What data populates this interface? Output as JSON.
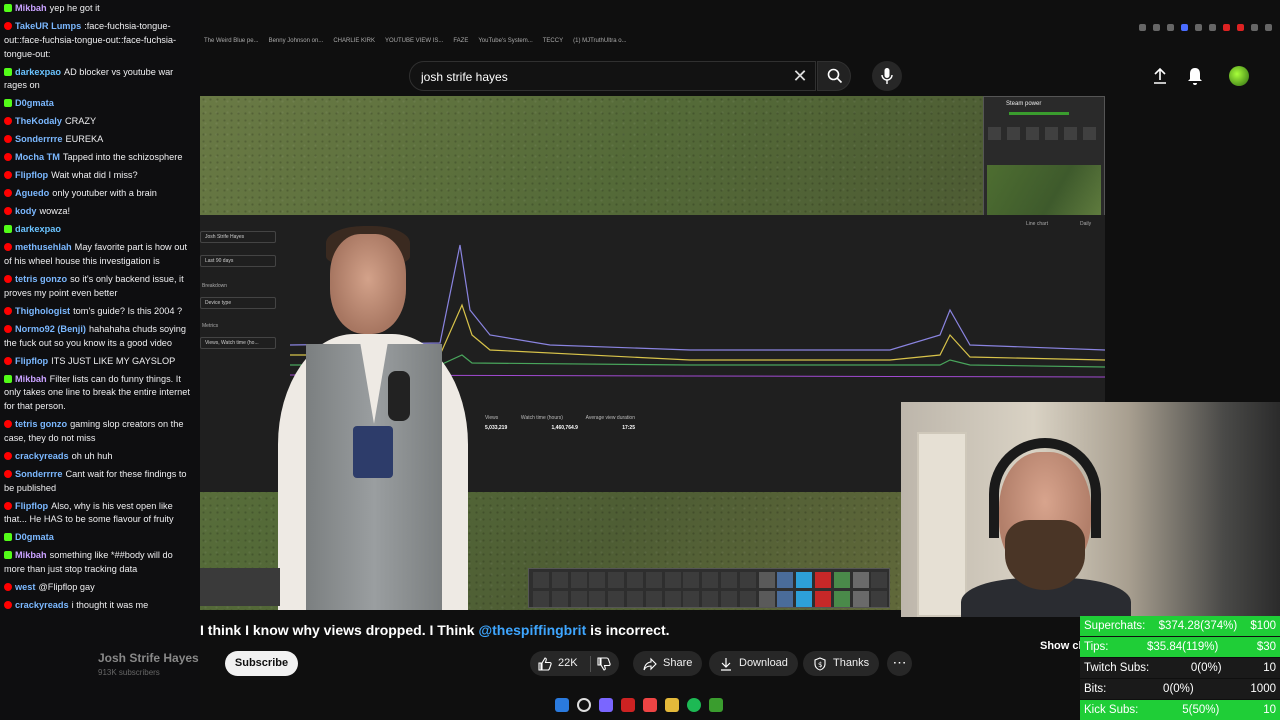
{
  "chat": {
    "messages": [
      {
        "user": "Mikbah",
        "text": "yep he got it",
        "platform": "kick",
        "color": "#c9a1ff"
      },
      {
        "user": "TakeUR Lumps",
        "text": ":face-fuchsia-tongue-out::face-fuchsia-tongue-out::face-fuchsia-tongue-out:",
        "platform": "yt",
        "color": "#7bb8ff"
      },
      {
        "user": "darkexpao",
        "text": "AD blocker vs youtube war rages on",
        "platform": "kick",
        "color": "#6ac3ff"
      },
      {
        "user": "D0gmata",
        "text": "",
        "platform": "kick",
        "color": "#7bb8ff"
      },
      {
        "user": "TheKodaly",
        "text": "CRAZY",
        "platform": "yt",
        "color": "#7bb8ff"
      },
      {
        "user": "Sonderrrre",
        "text": "EUREKA",
        "platform": "yt",
        "color": "#7bb8ff"
      },
      {
        "user": "Mocha TM",
        "text": "Tapped into the schizosphere",
        "platform": "yt",
        "color": "#7bb8ff"
      },
      {
        "user": "Flipflop",
        "text": "Wait what did I miss?",
        "platform": "yt",
        "color": "#7bb8ff"
      },
      {
        "user": "Aguedo",
        "text": "only youtuber with a brain",
        "platform": "yt",
        "color": "#7bb8ff"
      },
      {
        "user": "kody",
        "text": "wowza!",
        "platform": "yt",
        "color": "#7bb8ff"
      },
      {
        "user": "darkexpao",
        "text": "",
        "platform": "kick",
        "color": "#6ac3ff"
      },
      {
        "user": "methusehlah",
        "text": "May favorite part is how out of his wheel house this investigation is",
        "platform": "yt",
        "color": "#7bb8ff"
      },
      {
        "user": "tetris gonzo",
        "text": "so it's only backend issue, it proves my point even better",
        "platform": "yt",
        "color": "#7bb8ff"
      },
      {
        "user": "Thighologist",
        "text": "tom's guide? Is this 2004 ?",
        "platform": "yt",
        "color": "#7bb8ff"
      },
      {
        "user": "Normo92 (Benji)",
        "text": "hahahaha chuds soying the fuck out so you know its a good video",
        "platform": "yt",
        "color": "#7bb8ff"
      },
      {
        "user": "Flipflop",
        "text": "ITS JUST LIKE MY GAYSLOP",
        "platform": "yt",
        "color": "#7bb8ff"
      },
      {
        "user": "Mikbah",
        "text": "Filter lists can do funny things. It only takes one line to break the entire internet for that person.",
        "platform": "kick",
        "color": "#c9a1ff"
      },
      {
        "user": "tetris gonzo",
        "text": "gaming slop creators on the case, they do not miss",
        "platform": "yt",
        "color": "#7bb8ff"
      },
      {
        "user": "crackyreads",
        "text": "oh uh huh",
        "platform": "yt",
        "color": "#7bb8ff"
      },
      {
        "user": "Sonderrrre",
        "text": "Cant wait for these findings to be published",
        "platform": "yt",
        "color": "#7bb8ff"
      },
      {
        "user": "Flipflop",
        "text": "Also, why is his vest open like that... He HAS to be some flavour of fruity",
        "platform": "yt",
        "color": "#7bb8ff"
      },
      {
        "user": "D0gmata",
        "text": "",
        "platform": "kick",
        "color": "#7bb8ff"
      },
      {
        "user": "Mikbah",
        "text": "something like *##body will do more than just stop tracking data",
        "platform": "kick",
        "color": "#c9a1ff"
      },
      {
        "user": "west",
        "text": "@Flipflop gay",
        "platform": "yt",
        "color": "#7bb8ff"
      },
      {
        "user": "crackyreads",
        "text": "i thought it was me",
        "platform": "yt",
        "color": "#7bb8ff"
      }
    ]
  },
  "bookmarks": [
    "The Weird Blue pe...",
    "Benny Johnson on...",
    "CHARLIE KIRK",
    "YOUTUBE VIEW IS...",
    "FAZE",
    "YouTube's System...",
    "TECCY",
    "(1) MJTruthUltra o..."
  ],
  "search": {
    "value": "josh strife hayes",
    "placeholder": "Search"
  },
  "video": {
    "minimap_title": "Steam power",
    "analytics": {
      "channel_select": "Josh Strife Hayes",
      "range_select": "Last 90 days",
      "breakdown_label": "Breakdown",
      "device_select": "Device type",
      "metrics_label": "Metrics",
      "metric_select": "Views, Watch time (ho...",
      "chart_type": "Line chart",
      "interval": "Daily",
      "table_headers": [
        "Views",
        "Watch time (hours)",
        "Average view duration"
      ],
      "table_total": [
        "5,033,219",
        "1,460,764.9",
        "17:25"
      ],
      "x_ticks": [
        "Jul 14, 2025",
        "Jul 28, 2025",
        "Aug 12, 2025",
        "Aug 27, 2025",
        "Sep 11, 2025"
      ]
    }
  },
  "title": {
    "prefix": "I think I know why views dropped. I Think ",
    "mention": "@thespiffingbrit",
    "suffix": " is incorrect.",
    "overlap_text": "Q"
  },
  "channel": {
    "name": "Josh Strife Hayes",
    "subscribers": "913K subscribers"
  },
  "actions": {
    "subscribe": "Subscribe",
    "likes": "22K",
    "share": "Share",
    "download": "Download",
    "thanks": "Thanks",
    "more": "⋯",
    "show_chat": "Show ch"
  },
  "stats": [
    {
      "label": "Superchats:",
      "value": "$374.28(374%)",
      "goal": "$100",
      "style": "green"
    },
    {
      "label": "Tips:",
      "value": "$35.84(119%)",
      "goal": "$30",
      "style": "green"
    },
    {
      "label": "Twitch Subs:",
      "value": "0(0%)",
      "goal": "10",
      "style": "dark"
    },
    {
      "label": "Bits:",
      "value": "0(0%)",
      "goal": "1000",
      "style": "dark"
    },
    {
      "label": "Kick Subs:",
      "value": "5(50%)",
      "goal": "10",
      "style": "green"
    }
  ]
}
